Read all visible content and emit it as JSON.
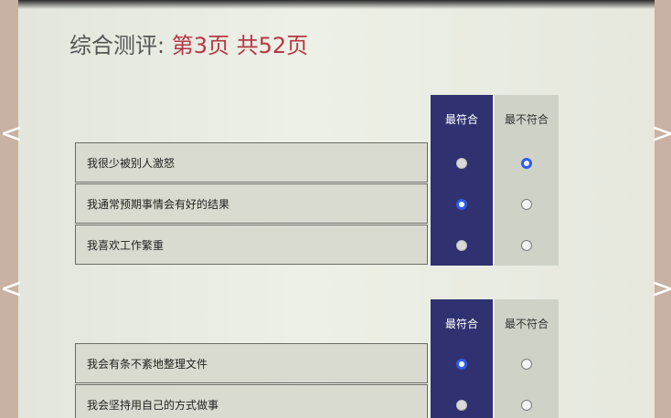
{
  "header": {
    "title": "综合测评:",
    "page_info": "第3页 共52页"
  },
  "nav": {
    "prev": "<",
    "next": ">"
  },
  "columns": {
    "most": "最符合",
    "least": "最不符合"
  },
  "groups": [
    {
      "items": [
        {
          "text": "我很少被别人激怒",
          "selected": "least"
        },
        {
          "text": "我通常预期事情会有好的结果",
          "selected": "most"
        },
        {
          "text": "我喜欢工作繁重",
          "selected": null
        }
      ]
    },
    {
      "items": [
        {
          "text": "我会有条不紊地整理文件",
          "selected": "most"
        },
        {
          "text": "我会坚持用自己的方式做事",
          "selected": null
        }
      ]
    }
  ],
  "colors": {
    "accent_column": "#2f3170",
    "radio_checked": "#2f5de8",
    "page_info": "#b63745"
  }
}
